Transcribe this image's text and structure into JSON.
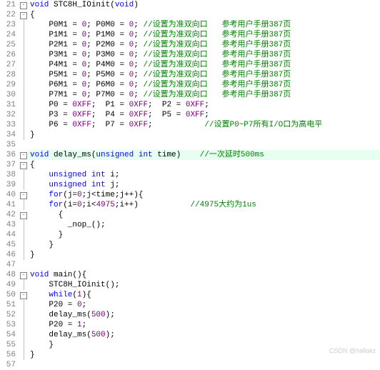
{
  "watermark": "CSDN @hallokz",
  "lines": [
    {
      "n": 21,
      "fold": "box",
      "hl": false,
      "tokens": [
        {
          "c": "tok-kw",
          "t": "void"
        },
        {
          "c": "tok-id",
          "t": " STC8H_IOinit("
        },
        {
          "c": "tok-kw",
          "t": "void"
        },
        {
          "c": "tok-id",
          "t": ")"
        }
      ]
    },
    {
      "n": 22,
      "fold": "box",
      "hl": false,
      "tokens": [
        {
          "c": "tok-id",
          "t": "{"
        }
      ]
    },
    {
      "n": 23,
      "fold": "line",
      "hl": false,
      "tokens": [
        {
          "c": "tok-id",
          "t": "    P0M1 = "
        },
        {
          "c": "tok-num",
          "t": "0"
        },
        {
          "c": "tok-id",
          "t": "; P0M0 = "
        },
        {
          "c": "tok-num",
          "t": "0"
        },
        {
          "c": "tok-id",
          "t": "; "
        },
        {
          "c": "tok-comment",
          "t": "//设置为准双向口   参考用户手册387页"
        }
      ]
    },
    {
      "n": 24,
      "fold": "line",
      "hl": false,
      "tokens": [
        {
          "c": "tok-id",
          "t": "    P1M1 = "
        },
        {
          "c": "tok-num",
          "t": "0"
        },
        {
          "c": "tok-id",
          "t": "; P1M0 = "
        },
        {
          "c": "tok-num",
          "t": "0"
        },
        {
          "c": "tok-id",
          "t": "; "
        },
        {
          "c": "tok-comment",
          "t": "//设置为准双向口   参考用户手册387页"
        }
      ]
    },
    {
      "n": 25,
      "fold": "line",
      "hl": false,
      "tokens": [
        {
          "c": "tok-id",
          "t": "    P2M1 = "
        },
        {
          "c": "tok-num",
          "t": "0"
        },
        {
          "c": "tok-id",
          "t": "; P2M0 = "
        },
        {
          "c": "tok-num",
          "t": "0"
        },
        {
          "c": "tok-id",
          "t": "; "
        },
        {
          "c": "tok-comment",
          "t": "//设置为准双向口   参考用户手册387页"
        }
      ]
    },
    {
      "n": 26,
      "fold": "line",
      "hl": false,
      "tokens": [
        {
          "c": "tok-id",
          "t": "    P3M1 = "
        },
        {
          "c": "tok-num",
          "t": "0"
        },
        {
          "c": "tok-id",
          "t": "; P3M0 = "
        },
        {
          "c": "tok-num",
          "t": "0"
        },
        {
          "c": "tok-id",
          "t": "; "
        },
        {
          "c": "tok-comment",
          "t": "//设置为准双向口   参考用户手册387页"
        }
      ]
    },
    {
      "n": 27,
      "fold": "line",
      "hl": false,
      "tokens": [
        {
          "c": "tok-id",
          "t": "    P4M1 = "
        },
        {
          "c": "tok-num",
          "t": "0"
        },
        {
          "c": "tok-id",
          "t": "; P4M0 = "
        },
        {
          "c": "tok-num",
          "t": "0"
        },
        {
          "c": "tok-id",
          "t": "; "
        },
        {
          "c": "tok-comment",
          "t": "//设置为准双向口   参考用户手册387页"
        }
      ]
    },
    {
      "n": 28,
      "fold": "line",
      "hl": false,
      "tokens": [
        {
          "c": "tok-id",
          "t": "    P5M1 = "
        },
        {
          "c": "tok-num",
          "t": "0"
        },
        {
          "c": "tok-id",
          "t": "; P5M0 = "
        },
        {
          "c": "tok-num",
          "t": "0"
        },
        {
          "c": "tok-id",
          "t": "; "
        },
        {
          "c": "tok-comment",
          "t": "//设置为准双向口   参考用户手册387页"
        }
      ]
    },
    {
      "n": 29,
      "fold": "line",
      "hl": false,
      "tokens": [
        {
          "c": "tok-id",
          "t": "    P6M1 = "
        },
        {
          "c": "tok-num",
          "t": "0"
        },
        {
          "c": "tok-id",
          "t": "; P6M0 = "
        },
        {
          "c": "tok-num",
          "t": "0"
        },
        {
          "c": "tok-id",
          "t": "; "
        },
        {
          "c": "tok-comment",
          "t": "//设置为准双向口   参考用户手册387页"
        }
      ]
    },
    {
      "n": 30,
      "fold": "line",
      "hl": false,
      "tokens": [
        {
          "c": "tok-id",
          "t": "    P7M1 = "
        },
        {
          "c": "tok-num",
          "t": "0"
        },
        {
          "c": "tok-id",
          "t": "; P7M0 = "
        },
        {
          "c": "tok-num",
          "t": "0"
        },
        {
          "c": "tok-id",
          "t": "; "
        },
        {
          "c": "tok-comment",
          "t": "//设置为准双向口   参考用户手册387页"
        }
      ]
    },
    {
      "n": 31,
      "fold": "line",
      "hl": false,
      "tokens": [
        {
          "c": "tok-id",
          "t": "    P0 = "
        },
        {
          "c": "tok-num",
          "t": "0XFF"
        },
        {
          "c": "tok-id",
          "t": ";  P1 = "
        },
        {
          "c": "tok-num",
          "t": "0XFF"
        },
        {
          "c": "tok-id",
          "t": ";  P2 = "
        },
        {
          "c": "tok-num",
          "t": "0XFF"
        },
        {
          "c": "tok-id",
          "t": ";"
        }
      ]
    },
    {
      "n": 32,
      "fold": "line",
      "hl": false,
      "tokens": [
        {
          "c": "tok-id",
          "t": "    P3 = "
        },
        {
          "c": "tok-num",
          "t": "0XFF"
        },
        {
          "c": "tok-id",
          "t": ";  P4 = "
        },
        {
          "c": "tok-num",
          "t": "0XFF"
        },
        {
          "c": "tok-id",
          "t": ";  P5 = "
        },
        {
          "c": "tok-num",
          "t": "0XFF"
        },
        {
          "c": "tok-id",
          "t": ";"
        }
      ]
    },
    {
      "n": 33,
      "fold": "line",
      "hl": false,
      "tokens": [
        {
          "c": "tok-id",
          "t": "    P6 = "
        },
        {
          "c": "tok-num",
          "t": "0XFF"
        },
        {
          "c": "tok-id",
          "t": ";  P7 = "
        },
        {
          "c": "tok-num",
          "t": "0XFF"
        },
        {
          "c": "tok-id",
          "t": ";           "
        },
        {
          "c": "tok-comment",
          "t": "//设置P0~P7所有I/O口为高电平"
        }
      ]
    },
    {
      "n": 34,
      "fold": "end",
      "hl": false,
      "tokens": [
        {
          "c": "tok-id",
          "t": "}"
        }
      ]
    },
    {
      "n": 35,
      "fold": "",
      "hl": false,
      "tokens": [
        {
          "c": "tok-id",
          "t": ""
        }
      ]
    },
    {
      "n": 36,
      "fold": "box",
      "hl": true,
      "tokens": [
        {
          "c": "tok-kw",
          "t": "void"
        },
        {
          "c": "tok-id",
          "t": " delay_ms("
        },
        {
          "c": "tok-kw",
          "t": "unsigned"
        },
        {
          "c": "tok-id",
          "t": " "
        },
        {
          "c": "tok-kw",
          "t": "int"
        },
        {
          "c": "tok-id",
          "t": " time)    "
        },
        {
          "c": "tok-comment",
          "t": "//一次延时500ms"
        }
      ]
    },
    {
      "n": 37,
      "fold": "box",
      "hl": false,
      "tokens": [
        {
          "c": "tok-id",
          "t": "{"
        }
      ]
    },
    {
      "n": 38,
      "fold": "line",
      "hl": false,
      "tokens": [
        {
          "c": "tok-id",
          "t": "    "
        },
        {
          "c": "tok-kw",
          "t": "unsigned"
        },
        {
          "c": "tok-id",
          "t": " "
        },
        {
          "c": "tok-kw",
          "t": "int"
        },
        {
          "c": "tok-id",
          "t": " i;"
        }
      ]
    },
    {
      "n": 39,
      "fold": "line",
      "hl": false,
      "tokens": [
        {
          "c": "tok-id",
          "t": "    "
        },
        {
          "c": "tok-kw",
          "t": "unsigned"
        },
        {
          "c": "tok-id",
          "t": " "
        },
        {
          "c": "tok-kw",
          "t": "int"
        },
        {
          "c": "tok-id",
          "t": " j;"
        }
      ]
    },
    {
      "n": 40,
      "fold": "box",
      "hl": false,
      "tokens": [
        {
          "c": "tok-id",
          "t": "    "
        },
        {
          "c": "tok-kw",
          "t": "for"
        },
        {
          "c": "tok-id",
          "t": "(j="
        },
        {
          "c": "tok-num",
          "t": "0"
        },
        {
          "c": "tok-id",
          "t": ";j<time;j++){"
        }
      ]
    },
    {
      "n": 41,
      "fold": "line",
      "hl": false,
      "tokens": [
        {
          "c": "tok-id",
          "t": "    "
        },
        {
          "c": "tok-kw",
          "t": "for"
        },
        {
          "c": "tok-id",
          "t": "(i="
        },
        {
          "c": "tok-num",
          "t": "0"
        },
        {
          "c": "tok-id",
          "t": ";i<"
        },
        {
          "c": "tok-num",
          "t": "4975"
        },
        {
          "c": "tok-id",
          "t": ";i++)           "
        },
        {
          "c": "tok-comment",
          "t": "//4975大约为1us"
        }
      ]
    },
    {
      "n": 42,
      "fold": "box",
      "hl": false,
      "tokens": [
        {
          "c": "tok-id",
          "t": "      {"
        }
      ]
    },
    {
      "n": 43,
      "fold": "line",
      "hl": false,
      "tokens": [
        {
          "c": "tok-id",
          "t": "        _nop_();"
        }
      ]
    },
    {
      "n": 44,
      "fold": "end",
      "hl": false,
      "tokens": [
        {
          "c": "tok-id",
          "t": "      }"
        }
      ]
    },
    {
      "n": 45,
      "fold": "end",
      "hl": false,
      "tokens": [
        {
          "c": "tok-id",
          "t": "    }"
        }
      ]
    },
    {
      "n": 46,
      "fold": "end",
      "hl": false,
      "tokens": [
        {
          "c": "tok-id",
          "t": "}"
        }
      ]
    },
    {
      "n": 47,
      "fold": "",
      "hl": false,
      "tokens": [
        {
          "c": "tok-id",
          "t": ""
        }
      ]
    },
    {
      "n": 48,
      "fold": "box",
      "hl": false,
      "tokens": [
        {
          "c": "tok-kw",
          "t": "void"
        },
        {
          "c": "tok-id",
          "t": " main(){"
        }
      ]
    },
    {
      "n": 49,
      "fold": "line",
      "hl": false,
      "tokens": [
        {
          "c": "tok-id",
          "t": "    STC8H_IOinit();"
        }
      ]
    },
    {
      "n": 50,
      "fold": "box",
      "hl": false,
      "tokens": [
        {
          "c": "tok-id",
          "t": "    "
        },
        {
          "c": "tok-kw",
          "t": "while"
        },
        {
          "c": "tok-id",
          "t": "("
        },
        {
          "c": "tok-num",
          "t": "1"
        },
        {
          "c": "tok-id",
          "t": "){"
        }
      ]
    },
    {
      "n": 51,
      "fold": "line",
      "hl": false,
      "tokens": [
        {
          "c": "tok-id",
          "t": "    P20 = "
        },
        {
          "c": "tok-num",
          "t": "0"
        },
        {
          "c": "tok-id",
          "t": ";"
        }
      ]
    },
    {
      "n": 52,
      "fold": "line",
      "hl": false,
      "tokens": [
        {
          "c": "tok-id",
          "t": "    delay_ms("
        },
        {
          "c": "tok-num",
          "t": "500"
        },
        {
          "c": "tok-id",
          "t": ");"
        }
      ]
    },
    {
      "n": 53,
      "fold": "line",
      "hl": false,
      "tokens": [
        {
          "c": "tok-id",
          "t": "    P20 = "
        },
        {
          "c": "tok-num",
          "t": "1"
        },
        {
          "c": "tok-id",
          "t": ";"
        }
      ]
    },
    {
      "n": 54,
      "fold": "line",
      "hl": false,
      "tokens": [
        {
          "c": "tok-id",
          "t": "    delay_ms("
        },
        {
          "c": "tok-num",
          "t": "500"
        },
        {
          "c": "tok-id",
          "t": ");"
        }
      ]
    },
    {
      "n": 55,
      "fold": "end",
      "hl": false,
      "tokens": [
        {
          "c": "tok-id",
          "t": "    }"
        }
      ]
    },
    {
      "n": 56,
      "fold": "end",
      "hl": false,
      "tokens": [
        {
          "c": "tok-id",
          "t": "}"
        }
      ]
    },
    {
      "n": 57,
      "fold": "",
      "hl": false,
      "tokens": [
        {
          "c": "tok-id",
          "t": ""
        }
      ]
    }
  ]
}
